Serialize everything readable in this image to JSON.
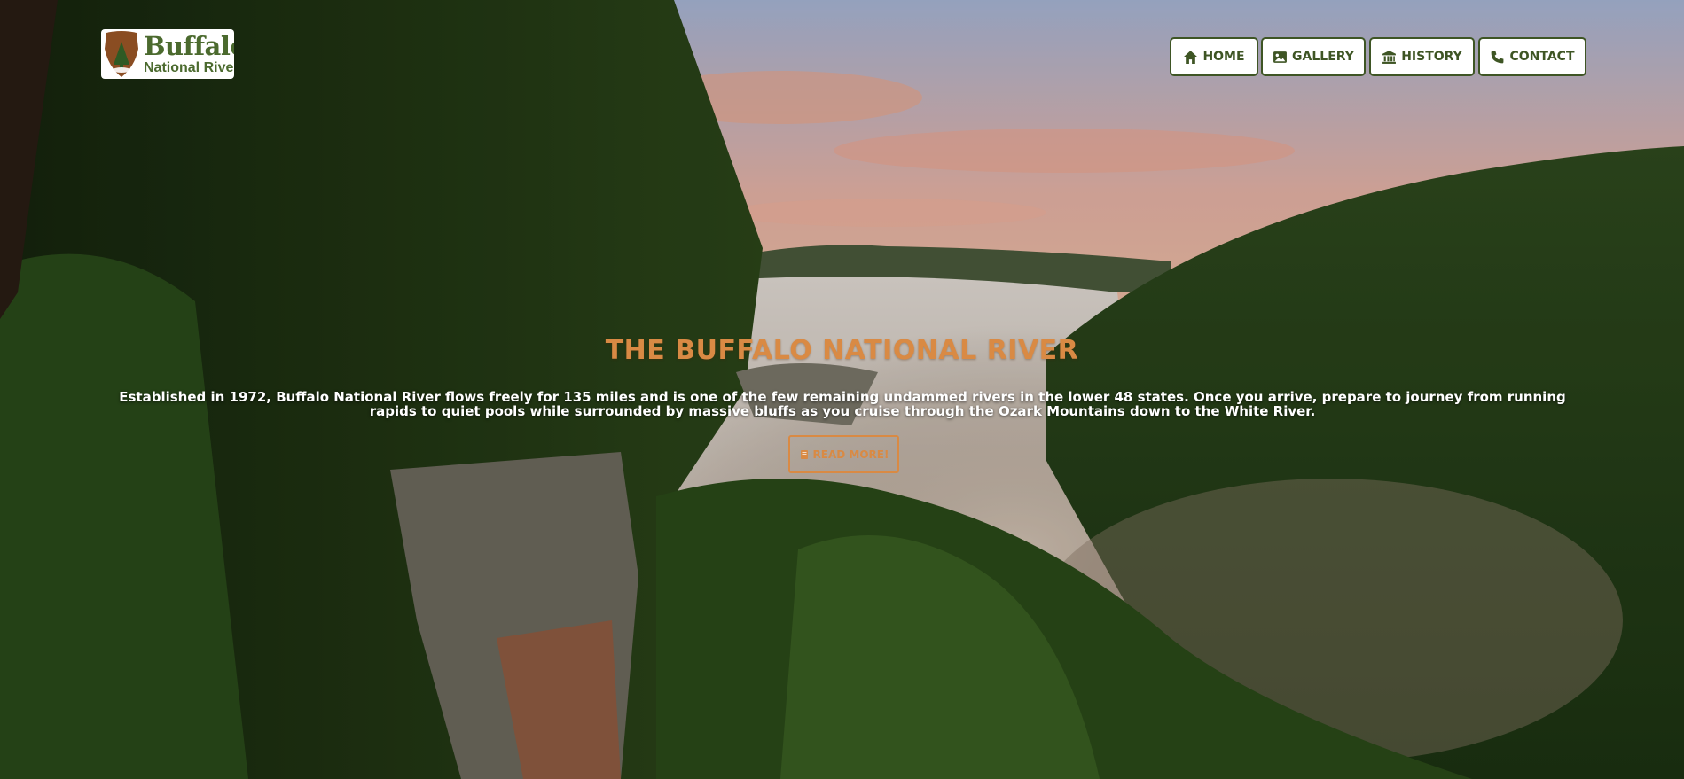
{
  "logo": {
    "title": "Buffalo",
    "subtitle": "National River"
  },
  "nav": {
    "items": [
      {
        "label": "HOME",
        "icon": "home-icon"
      },
      {
        "label": "GALLERY",
        "icon": "image-icon"
      },
      {
        "label": "HISTORY",
        "icon": "landmark-icon"
      },
      {
        "label": "CONTACT",
        "icon": "phone-icon"
      }
    ]
  },
  "hero": {
    "title": "THE BUFFALO NATIONAL RIVER",
    "description": "Established in 1972, Buffalo National River flows freely for 135 miles and is one of the few remaining undammed rivers in the lower 48 states. Once you arrive, prepare to journey from running rapids to quiet pools while surrounded by massive bluffs as you cruise through the Ozark Mountains down to the White River.",
    "button_label": "READ MORE!",
    "button_icon": "book-icon"
  },
  "colors": {
    "accent": "#d98a44",
    "nav_text": "#3e5524",
    "logo_green": "#4b6a2e"
  }
}
